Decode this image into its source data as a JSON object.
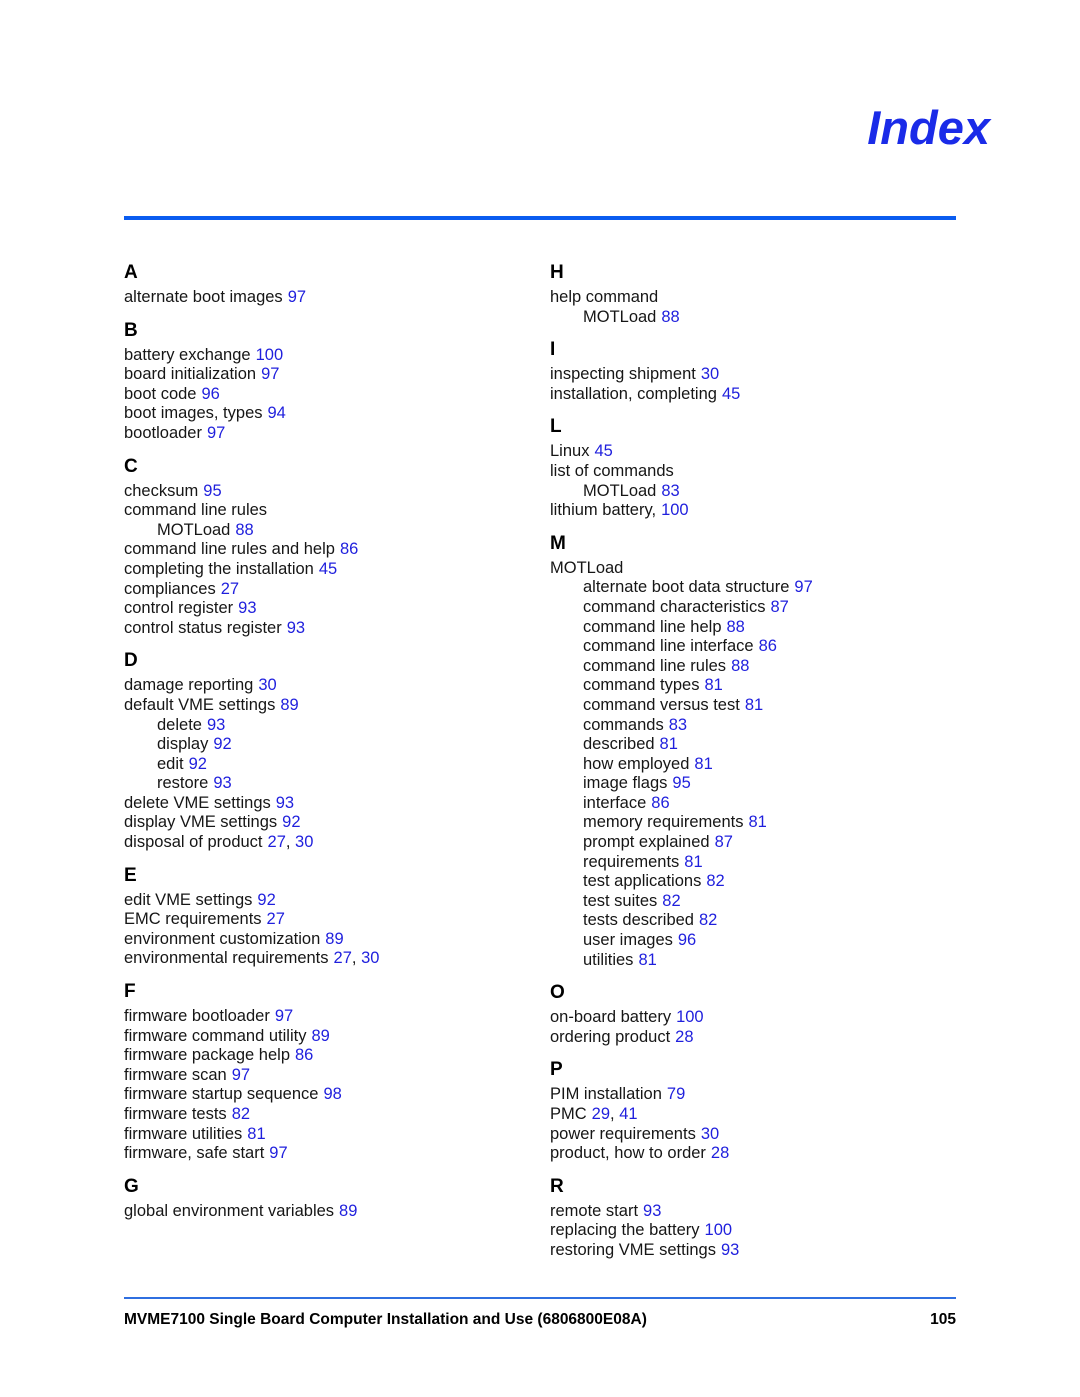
{
  "document": {
    "title": "Index",
    "footer_text": "MVME7100 Single Board Computer Installation and Use (6806800E08A)",
    "footer_page": "105"
  },
  "colors": {
    "title_blue": "#1a2be8",
    "rule_blue": "#0a5cf0",
    "page_number_blue": "#1f1fdd",
    "text_black": "#161616"
  },
  "columns": [
    {
      "name": "left",
      "groups": [
        {
          "letter": "A",
          "entries": [
            {
              "term": "alternate boot images",
              "pages": "97",
              "sub": false
            }
          ]
        },
        {
          "letter": "B",
          "entries": [
            {
              "term": "battery exchange",
              "pages": "100",
              "sub": false
            },
            {
              "term": "board initialization",
              "pages": "97",
              "sub": false
            },
            {
              "term": "boot code",
              "pages": "96",
              "sub": false
            },
            {
              "term": "boot images, types",
              "pages": "94",
              "sub": false
            },
            {
              "term": "bootloader",
              "pages": "97",
              "sub": false
            }
          ]
        },
        {
          "letter": "C",
          "entries": [
            {
              "term": "checksum",
              "pages": "95",
              "sub": false
            },
            {
              "term": "command line rules",
              "pages": "",
              "sub": false
            },
            {
              "term": "MOTLoad",
              "pages": "88",
              "sub": true
            },
            {
              "term": "command line rules and help",
              "pages": "86",
              "sub": false
            },
            {
              "term": "completing the installation",
              "pages": "45",
              "sub": false
            },
            {
              "term": "compliances",
              "pages": "27",
              "sub": false
            },
            {
              "term": "control register",
              "pages": "93",
              "sub": false
            },
            {
              "term": "control status register",
              "pages": "93",
              "sub": false
            }
          ]
        },
        {
          "letter": "D",
          "entries": [
            {
              "term": "damage reporting",
              "pages": "30",
              "sub": false
            },
            {
              "term": "default VME settings",
              "pages": "89",
              "sub": false
            },
            {
              "term": "delete",
              "pages": "93",
              "sub": true
            },
            {
              "term": "display",
              "pages": "92",
              "sub": true
            },
            {
              "term": "edit",
              "pages": "92",
              "sub": true
            },
            {
              "term": "restore",
              "pages": "93",
              "sub": true
            },
            {
              "term": "delete VME settings",
              "pages": "93",
              "sub": false
            },
            {
              "term": "display VME settings",
              "pages": "92",
              "sub": false
            },
            {
              "term": "disposal of product",
              "pages": "27, 30",
              "sub": false
            }
          ]
        },
        {
          "letter": "E",
          "entries": [
            {
              "term": "edit VME settings",
              "pages": "92",
              "sub": false
            },
            {
              "term": "EMC requirements",
              "pages": "27",
              "sub": false
            },
            {
              "term": "environment customization",
              "pages": "89",
              "sub": false
            },
            {
              "term": "environmental requirements",
              "pages": "27, 30",
              "sub": false
            }
          ]
        },
        {
          "letter": "F",
          "entries": [
            {
              "term": "firmware bootloader",
              "pages": "97",
              "sub": false
            },
            {
              "term": "firmware command utility",
              "pages": "89",
              "sub": false
            },
            {
              "term": "firmware package help",
              "pages": "86",
              "sub": false
            },
            {
              "term": "firmware scan",
              "pages": "97",
              "sub": false
            },
            {
              "term": "firmware startup sequence",
              "pages": "98",
              "sub": false
            },
            {
              "term": "firmware tests",
              "pages": "82",
              "sub": false
            },
            {
              "term": "firmware utilities",
              "pages": "81",
              "sub": false
            },
            {
              "term": "firmware, safe start",
              "pages": "97",
              "sub": false
            }
          ]
        },
        {
          "letter": "G",
          "entries": [
            {
              "term": "global environment variables",
              "pages": "89",
              "sub": false
            }
          ]
        }
      ]
    },
    {
      "name": "right",
      "groups": [
        {
          "letter": "H",
          "entries": [
            {
              "term": "help command",
              "pages": "",
              "sub": false
            },
            {
              "term": "MOTLoad",
              "pages": "88",
              "sub": true
            }
          ]
        },
        {
          "letter": "I",
          "entries": [
            {
              "term": "inspecting shipment",
              "pages": "30",
              "sub": false
            },
            {
              "term": "installation, completing",
              "pages": "45",
              "sub": false
            }
          ]
        },
        {
          "letter": "L",
          "entries": [
            {
              "term": "Linux",
              "pages": "45",
              "sub": false
            },
            {
              "term": "list of commands",
              "pages": "",
              "sub": false
            },
            {
              "term": "MOTLoad",
              "pages": "83",
              "sub": true
            },
            {
              "term": "lithium battery,",
              "pages": "100",
              "sub": false
            }
          ]
        },
        {
          "letter": "M",
          "entries": [
            {
              "term": "MOTLoad",
              "pages": "",
              "sub": false
            },
            {
              "term": "alternate boot data structure",
              "pages": "97",
              "sub": true
            },
            {
              "term": "command characteristics",
              "pages": "87",
              "sub": true
            },
            {
              "term": "command line help",
              "pages": "88",
              "sub": true
            },
            {
              "term": "command line interface",
              "pages": "86",
              "sub": true
            },
            {
              "term": "command line rules",
              "pages": "88",
              "sub": true
            },
            {
              "term": "command types",
              "pages": "81",
              "sub": true
            },
            {
              "term": "command versus test",
              "pages": "81",
              "sub": true
            },
            {
              "term": "commands",
              "pages": "83",
              "sub": true
            },
            {
              "term": "described",
              "pages": "81",
              "sub": true
            },
            {
              "term": "how employed",
              "pages": "81",
              "sub": true
            },
            {
              "term": "image flags",
              "pages": "95",
              "sub": true
            },
            {
              "term": "interface",
              "pages": "86",
              "sub": true
            },
            {
              "term": "memory requirements",
              "pages": "81",
              "sub": true
            },
            {
              "term": "prompt explained",
              "pages": "87",
              "sub": true
            },
            {
              "term": "requirements",
              "pages": "81",
              "sub": true
            },
            {
              "term": "test applications",
              "pages": "82",
              "sub": true
            },
            {
              "term": "test suites",
              "pages": "82",
              "sub": true
            },
            {
              "term": "tests described",
              "pages": "82",
              "sub": true
            },
            {
              "term": "user images",
              "pages": "96",
              "sub": true
            },
            {
              "term": "utilities",
              "pages": "81",
              "sub": true
            }
          ]
        },
        {
          "letter": "O",
          "entries": [
            {
              "term": "on-board battery",
              "pages": "100",
              "sub": false
            },
            {
              "term": "ordering product",
              "pages": "28",
              "sub": false
            }
          ]
        },
        {
          "letter": "P",
          "entries": [
            {
              "term": "PIM installation",
              "pages": "79",
              "sub": false
            },
            {
              "term": "PMC",
              "pages": "29, 41",
              "sub": false
            },
            {
              "term": "power requirements",
              "pages": "30",
              "sub": false
            },
            {
              "term": "product, how to order",
              "pages": "28",
              "sub": false
            }
          ]
        },
        {
          "letter": "R",
          "entries": [
            {
              "term": "remote start",
              "pages": "93",
              "sub": false
            },
            {
              "term": "replacing the battery",
              "pages": "100",
              "sub": false
            },
            {
              "term": "restoring VME settings",
              "pages": "93",
              "sub": false
            }
          ]
        }
      ]
    }
  ]
}
